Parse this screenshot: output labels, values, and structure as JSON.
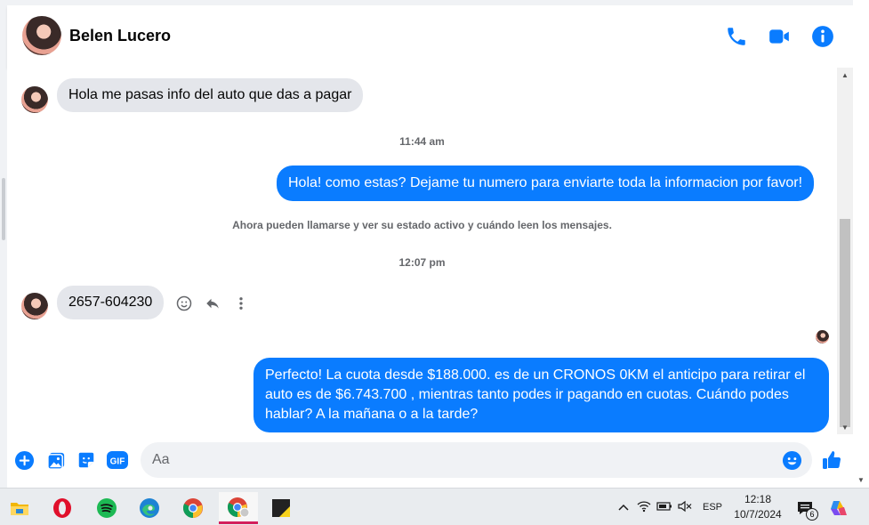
{
  "header": {
    "contact_name": "Belen Lucero",
    "icons": [
      "phone-icon",
      "video-call-icon",
      "info-icon"
    ],
    "accent": "#0a7cff"
  },
  "messages": {
    "incoming_1": "Hola me pasas info del auto que das a pagar",
    "timestamp_1": "11:44 am",
    "outgoing_1": "Hola! como estas? Dejame tu numero para enviarte toda la informacion por favor!",
    "notice": "Ahora pueden llamarse y ver su estado activo y cuándo leen los mensajes.",
    "timestamp_2": "12:07 pm",
    "incoming_2": "2657-604230",
    "outgoing_2": "Perfecto! La cuota desde $188.000. es de un CRONOS 0KM el anticipo para retirar el auto es de $6.743.700 , mientras tanto podes ir pagando en cuotas. Cuándo podes hablar? A la mañana o a la tarde?"
  },
  "composer": {
    "placeholder": "Aa",
    "icons": [
      "plus-icon",
      "image-icon",
      "sticker-icon",
      "gif-icon",
      "emoji-icon",
      "like-icon"
    ],
    "gif_label": "GIF"
  },
  "taskbar": {
    "apps": [
      "file-explorer-icon",
      "opera-icon",
      "spotify-icon",
      "edge-icon",
      "chrome-icon",
      "chrome-profile-icon",
      "sticky-notes-icon"
    ],
    "tray_language": "ESP",
    "time": "12:18",
    "date": "10/7/2024",
    "notification_count": "6"
  },
  "colors": {
    "incoming_bubble": "#e4e6eb",
    "outgoing_bubble": "#0a7cff",
    "taskbar_bg": "#e9ecef"
  }
}
